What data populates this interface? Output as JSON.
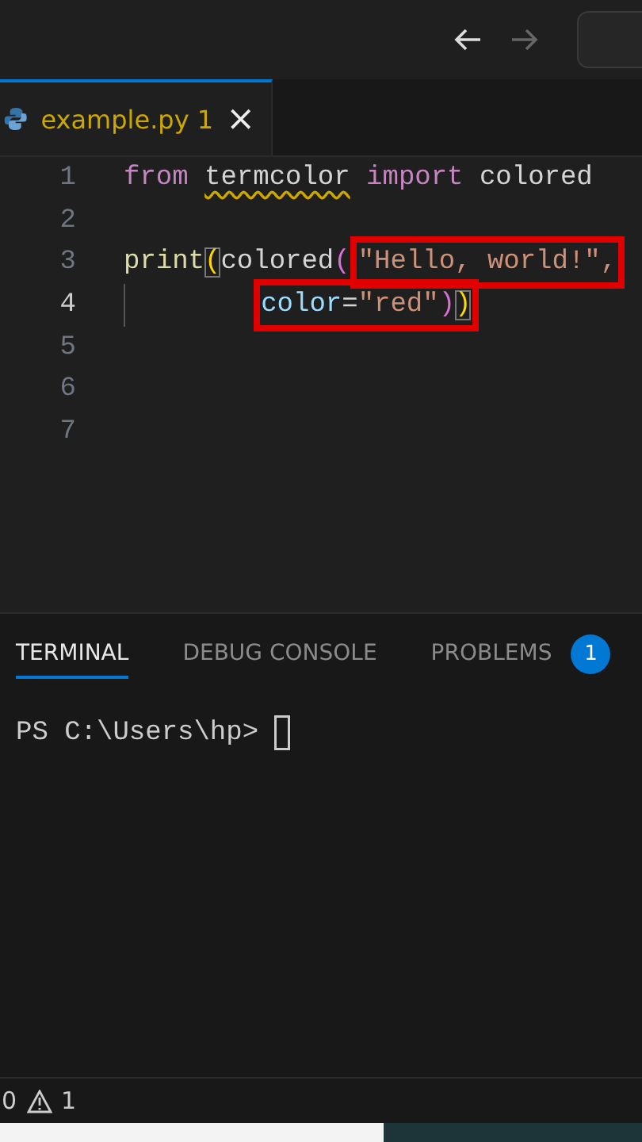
{
  "title_bar": {
    "back": {
      "disabled": false
    },
    "forward": {
      "disabled": true
    }
  },
  "editor_tab": {
    "label": "example.py 1",
    "selected": true,
    "has_warning": true,
    "close": "×"
  },
  "code_lines": [
    {
      "number": "1",
      "current": false,
      "tokens": [
        {
          "text": "from ",
          "kind": "keyword"
        },
        {
          "text": "termcolor",
          "kind": "module",
          "warning": true
        },
        {
          "text": " import",
          "kind": "keyword"
        },
        {
          "text": " colored",
          "kind": "plain"
        }
      ]
    },
    {
      "number": "2",
      "current": false
    },
    {
      "number": "3",
      "current": false,
      "tokens": [
        {
          "text": "print",
          "kind": "function"
        },
        {
          "text": "(",
          "kind": "bracket1",
          "matched": true
        },
        {
          "text": "colored",
          "kind": "plain"
        },
        {
          "text": "(",
          "kind": "bracket2"
        },
        {
          "kind": "highlight",
          "tokens": [
            {
              "text": "\"Hello, world!\",",
              "kind": "string"
            }
          ]
        }
      ]
    },
    {
      "number": "4",
      "current": true,
      "indent_guide": true,
      "tokens": [
        {
          "kind": "highlight",
          "tokens": [
            {
              "text": "color",
              "kind": "param"
            },
            {
              "text": "=",
              "kind": "plain"
            },
            {
              "text": "\"red\"",
              "kind": "string"
            },
            {
              "text": ")",
              "kind": "bracket2"
            },
            {
              "text": ")",
              "kind": "bracket1",
              "matched": true
            }
          ]
        }
      ]
    },
    {
      "number": "5",
      "current": false
    },
    {
      "number": "6",
      "current": false
    },
    {
      "number": "7",
      "current": false
    }
  ],
  "panel_tabs": [
    {
      "label": "TERMINAL",
      "selected": true
    },
    {
      "label": "DEBUG CONSOLE",
      "selected": false
    },
    {
      "label": "PROBLEMS",
      "selected": false,
      "badge": "1"
    }
  ],
  "terminal": {
    "prompt": "PS C:\\Users\\hp>"
  },
  "status_bar": {
    "errors": "0",
    "warnings": "1"
  }
}
